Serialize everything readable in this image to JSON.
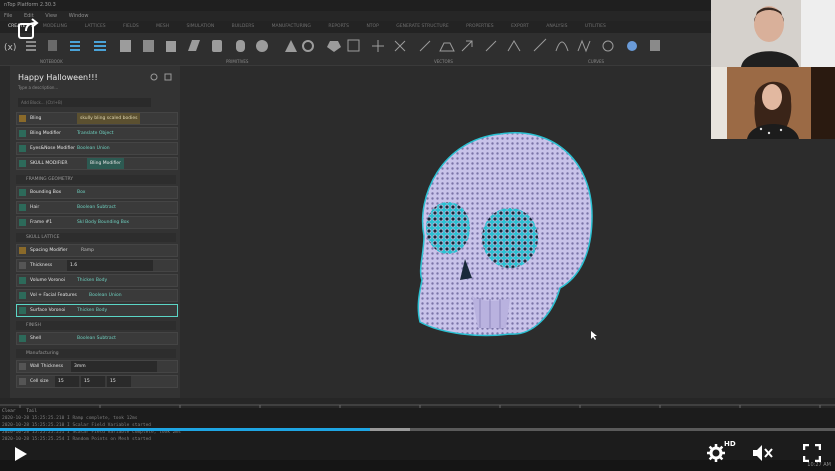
{
  "window": {
    "title": "nTop Platform 2.30.3"
  },
  "menubar": {
    "items": [
      "File",
      "Edit",
      "View",
      "Window"
    ]
  },
  "ribbon": {
    "tabs": [
      "CREATE",
      "MODELING",
      "LATTICES",
      "FIELDS",
      "MESH",
      "SIMULATION",
      "BUILDERS",
      "MANUFACTURING",
      "REPORTS",
      "NTOP",
      "GENERATE STRUCTURE",
      "PROPERTIES",
      "EXPORT",
      "ANALYSIS",
      "UTILITIES"
    ],
    "groups": [
      "NOTEBOOK",
      "PRIMITIVES",
      "VECTORS",
      "CURVES"
    ]
  },
  "notebook": {
    "title": "Happy Halloween!!!",
    "description": "Type a description...",
    "add_block_placeholder": "Add Block... (Ctrl+B)",
    "rows_top": [
      {
        "label": "Bling",
        "value": "skully bling scaled bodies"
      },
      {
        "label": "Bling Modifier",
        "value": "Translate Object"
      },
      {
        "label": "Eyes&Nose Modifier",
        "value": "Boolean Union"
      },
      {
        "label": "SKULL MODIFIER",
        "value": "Bling Modifier"
      }
    ],
    "section_frame": "FRAMING GEOMETRY",
    "rows_frame": [
      {
        "label": "Bounding Box",
        "value": "Box"
      },
      {
        "label": "Hair",
        "value": "Boolean Subtract"
      },
      {
        "label": "Frame #1",
        "value": "Skl Body Bounding Box"
      }
    ],
    "section_lattice": "SKULL LATTICE",
    "rows_lattice": [
      {
        "label": "Spacing Modifier",
        "value": "Ramp"
      },
      {
        "label": "Thickness",
        "value": "1.6"
      },
      {
        "label": "Volume Voronoi",
        "value": "Thicken Body"
      },
      {
        "label": "Vol + Facial Features",
        "value": "Boolean Union"
      },
      {
        "label": "Surface Voronoi",
        "value": "Thicken Body"
      }
    ],
    "section_finish": "FINISH",
    "rows_finish": [
      {
        "label": "Shell",
        "value": "Boolean Subtract"
      }
    ],
    "section_manufacturing": "Manufacturing",
    "rows_manufacturing": [
      {
        "label": "Wall Thickness",
        "value": "3mm"
      },
      {
        "label": "Cell size",
        "value": "15"
      }
    ]
  },
  "console": {
    "tabs": [
      "Clear",
      "Tail"
    ],
    "lines": [
      "2020-10-28 15:25:25.210   I   Ramp complete, took 12ms",
      "2020-10-28 15:25:25.210   I   Scalar Field Variable started",
      "2020-10-28 15:25:25.251   I   Scalar Field Variable complete, took 2ms",
      "2020-10-28 15:25:25.254   I   Random Points on Mesh started"
    ]
  },
  "video": {
    "progress": 0.443,
    "hd_label": "HD",
    "time": "10:27 AM"
  },
  "colors": {
    "accent": "#1ea5e3",
    "teal": "#5bd6c6",
    "skull": "#c9c3ea"
  }
}
